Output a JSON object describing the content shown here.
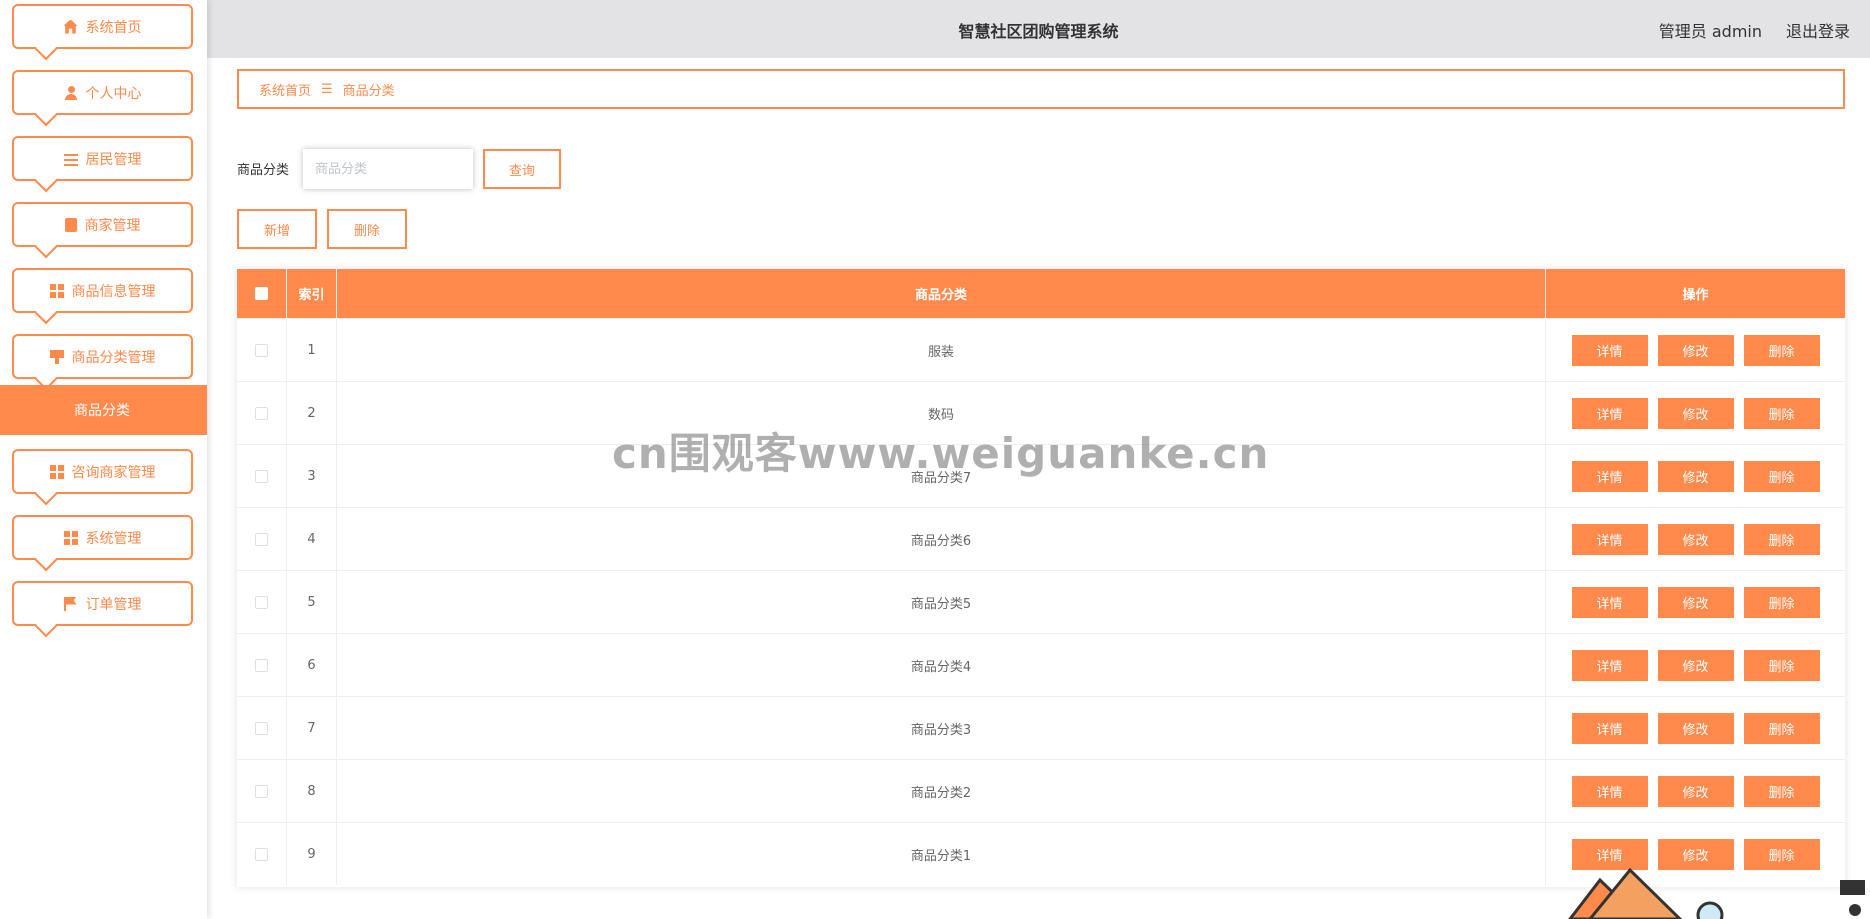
{
  "header": {
    "title": "智慧社区团购管理系统",
    "admin_label": "管理员 admin",
    "logout_label": "退出登录"
  },
  "sidebar": {
    "items": [
      {
        "label": "系统首页",
        "icon": "home-icon"
      },
      {
        "label": "个人中心",
        "icon": "user-icon"
      },
      {
        "label": "居民管理",
        "icon": "sliders-icon"
      },
      {
        "label": "商家管理",
        "icon": "clipboard-icon"
      },
      {
        "label": "商品信息管理",
        "icon": "grid-icon"
      },
      {
        "label": "商品分类管理",
        "icon": "brush-icon"
      },
      {
        "label": "咨询商家管理",
        "icon": "grid-icon"
      },
      {
        "label": "系统管理",
        "icon": "grid-icon"
      },
      {
        "label": "订单管理",
        "icon": "flag-icon"
      }
    ],
    "active_sub": "商品分类"
  },
  "breadcrumb": {
    "home": "系统首页",
    "separator": "☰",
    "current": "商品分类"
  },
  "search": {
    "label": "商品分类",
    "placeholder": "商品分类",
    "query_button": "查询"
  },
  "toolbar": {
    "add_label": "新增",
    "delete_label": "删除"
  },
  "table": {
    "headers": {
      "index": "索引",
      "name": "商品分类",
      "actions": "操作"
    },
    "rows": [
      {
        "index": "1",
        "name": "服装"
      },
      {
        "index": "2",
        "name": "数码"
      },
      {
        "index": "3",
        "name": "商品分类7"
      },
      {
        "index": "4",
        "name": "商品分类6"
      },
      {
        "index": "5",
        "name": "商品分类5"
      },
      {
        "index": "6",
        "name": "商品分类4"
      },
      {
        "index": "7",
        "name": "商品分类3"
      },
      {
        "index": "8",
        "name": "商品分类2"
      },
      {
        "index": "9",
        "name": "商品分类1"
      }
    ],
    "actions": {
      "detail": "详情",
      "edit": "修改",
      "delete": "删除"
    }
  },
  "watermark": "cn围观客www.weiguanke.cn",
  "colors": {
    "accent": "#ff8a4c",
    "topbar": "#e3e2e4"
  }
}
